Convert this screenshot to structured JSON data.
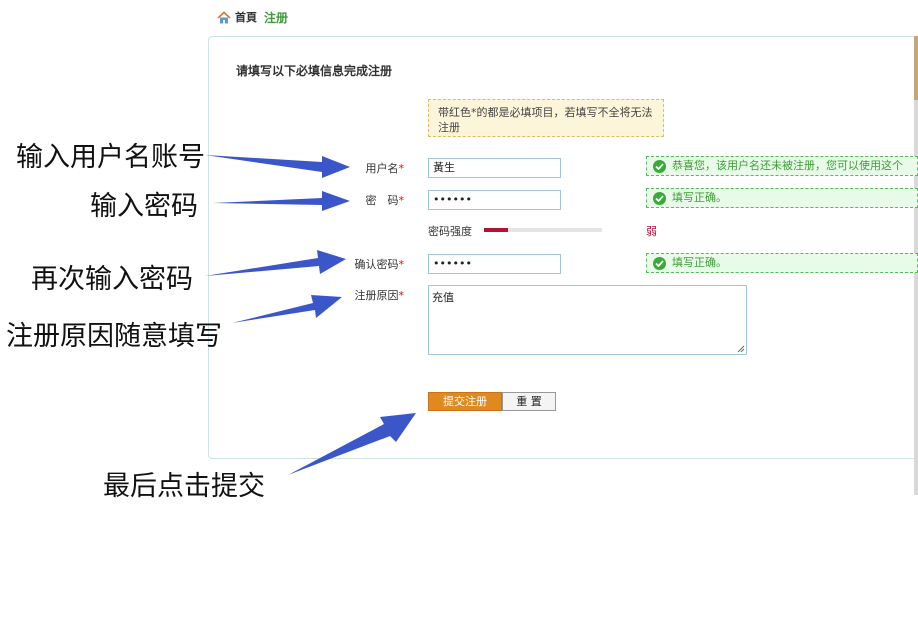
{
  "breadcrumb": {
    "home": "首頁",
    "current": "注册"
  },
  "form": {
    "heading": "请填写以下必填信息完成注册",
    "notice": "带红色*的都是必填项目，若填写不全将无法注册",
    "required_mark": "*",
    "username": {
      "label": "用户名",
      "value": "黃生",
      "status": "恭喜您，该用户名还未被注册，您可以使用这个"
    },
    "password": {
      "label": "密　码",
      "value": "••••••",
      "status": "填写正确。"
    },
    "strength": {
      "label": "密码强度",
      "level": 0.2,
      "text": "弱"
    },
    "confirm": {
      "label": "确认密码",
      "value": "••••••",
      "status": "填写正确。"
    },
    "reason": {
      "label": "注册原因",
      "value": "充值"
    },
    "submit_label": "提交注册",
    "reset_label": "重 置"
  },
  "annotations": {
    "username": "输入用户名账号",
    "password": "输入密码",
    "confirm": "再次输入密码",
    "reason": "注册原因随意填写",
    "submit": "最后点击提交"
  },
  "colors": {
    "accent_green": "#3f9a3a",
    "submit_orange": "#e0891e",
    "arrow_blue": "#3a56c9",
    "weak_red": "#b0123a"
  }
}
